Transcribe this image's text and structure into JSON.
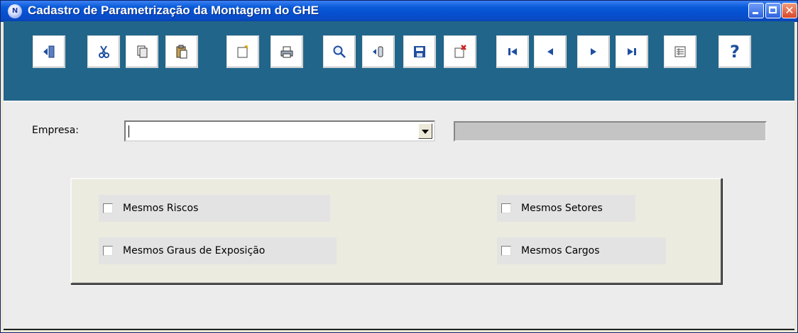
{
  "window": {
    "title": "Cadastro de Parametrização da Montagem do GHE",
    "app_icon_glyph": "N"
  },
  "toolbar": {
    "buttons": [
      {
        "name": "exit-button",
        "icon": "exit-door-icon"
      },
      {
        "name": "cut-button",
        "icon": "scissors-icon"
      },
      {
        "name": "copy-button",
        "icon": "copy-icon"
      },
      {
        "name": "paste-button",
        "icon": "paste-icon"
      },
      {
        "name": "new-record-button",
        "icon": "new-document-icon"
      },
      {
        "name": "print-button",
        "icon": "printer-icon"
      },
      {
        "name": "search-button",
        "icon": "magnifier-icon"
      },
      {
        "name": "insert-button",
        "icon": "insert-icon"
      },
      {
        "name": "save-button",
        "icon": "floppy-disk-icon"
      },
      {
        "name": "delete-button",
        "icon": "delete-document-icon"
      },
      {
        "name": "first-record-button",
        "icon": "first-icon"
      },
      {
        "name": "previous-record-button",
        "icon": "previous-icon"
      },
      {
        "name": "next-record-button",
        "icon": "next-icon"
      },
      {
        "name": "last-record-button",
        "icon": "last-icon"
      },
      {
        "name": "list-view-button",
        "icon": "list-icon"
      },
      {
        "name": "help-button",
        "icon": "question-mark-icon"
      }
    ],
    "help_glyph": "?"
  },
  "form": {
    "empresa_label": "Empresa:",
    "empresa_value": "",
    "descricao_value": ""
  },
  "options": {
    "mesmos_riscos": "Mesmos Riscos",
    "mesmos_graus": "Mesmos Graus de Exposição",
    "mesmos_setores": "Mesmos Setores",
    "mesmos_cargos": "Mesmos Cargos"
  },
  "colors": {
    "titlebar": "#0550d0",
    "toolbar_band": "#21658a",
    "icon_blue": "#1f4fa0",
    "delete_red": "#d02020"
  }
}
